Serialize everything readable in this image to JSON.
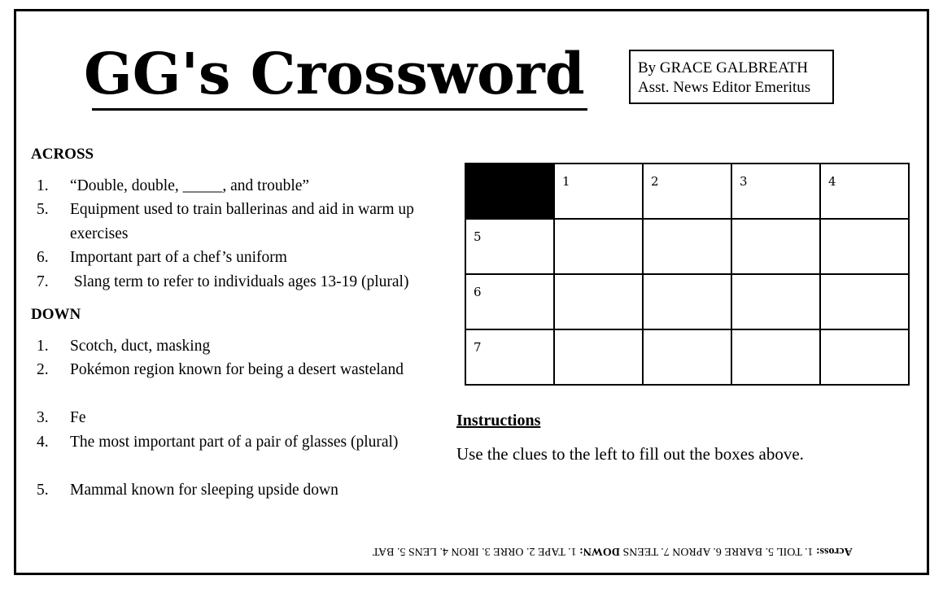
{
  "header": {
    "title": "GG's Crossword",
    "byline_name": "By GRACE GALBREATH",
    "byline_role": "Asst. News Editor Emeritus"
  },
  "across": {
    "heading": "ACROSS",
    "clues": [
      {
        "num": "1.",
        "text": "“Double, double, _____, and trouble”"
      },
      {
        "num": "5.",
        "text": "Equipment used to train ballerinas and aid in warm up exercises"
      },
      {
        "num": "6.",
        "text": "Important part of a chef’s uniform"
      },
      {
        "num": "7.",
        "text": " Slang term to refer to individuals ages 13-19 (plural)"
      }
    ]
  },
  "down": {
    "heading": "DOWN",
    "clues": [
      {
        "num": "1.",
        "text": "Scotch, duct, masking"
      },
      {
        "num": "2.",
        "text": "Pokémon region known for being a desert wasteland"
      },
      {
        "num": "3.",
        "text": "Fe"
      },
      {
        "num": "4.",
        "text": "The most important part of a pair of glasses (plural)"
      },
      {
        "num": "5.",
        "text": "Mammal known for sleeping upside down"
      }
    ]
  },
  "grid": {
    "rows": 4,
    "cols": 5,
    "black_cells": [
      [
        0,
        0
      ]
    ],
    "numbers": {
      "0-1": "1",
      "0-2": "2",
      "0-3": "3",
      "0-4": "4",
      "1-0": "5",
      "2-0": "6",
      "3-0": "7"
    }
  },
  "instructions": {
    "heading": "Instructions",
    "text": "Use the clues to the left to fill out the boxes above."
  },
  "answer_key": {
    "across_label": "Across:",
    "across_text": " 1. TOIL 5. BARRE 6. APRON 7. TEENS ",
    "down_label": "DOWN:",
    "down_text": " 1. TAPE 2. ORRE 3. IRON 4. LENS 5. BAT"
  }
}
